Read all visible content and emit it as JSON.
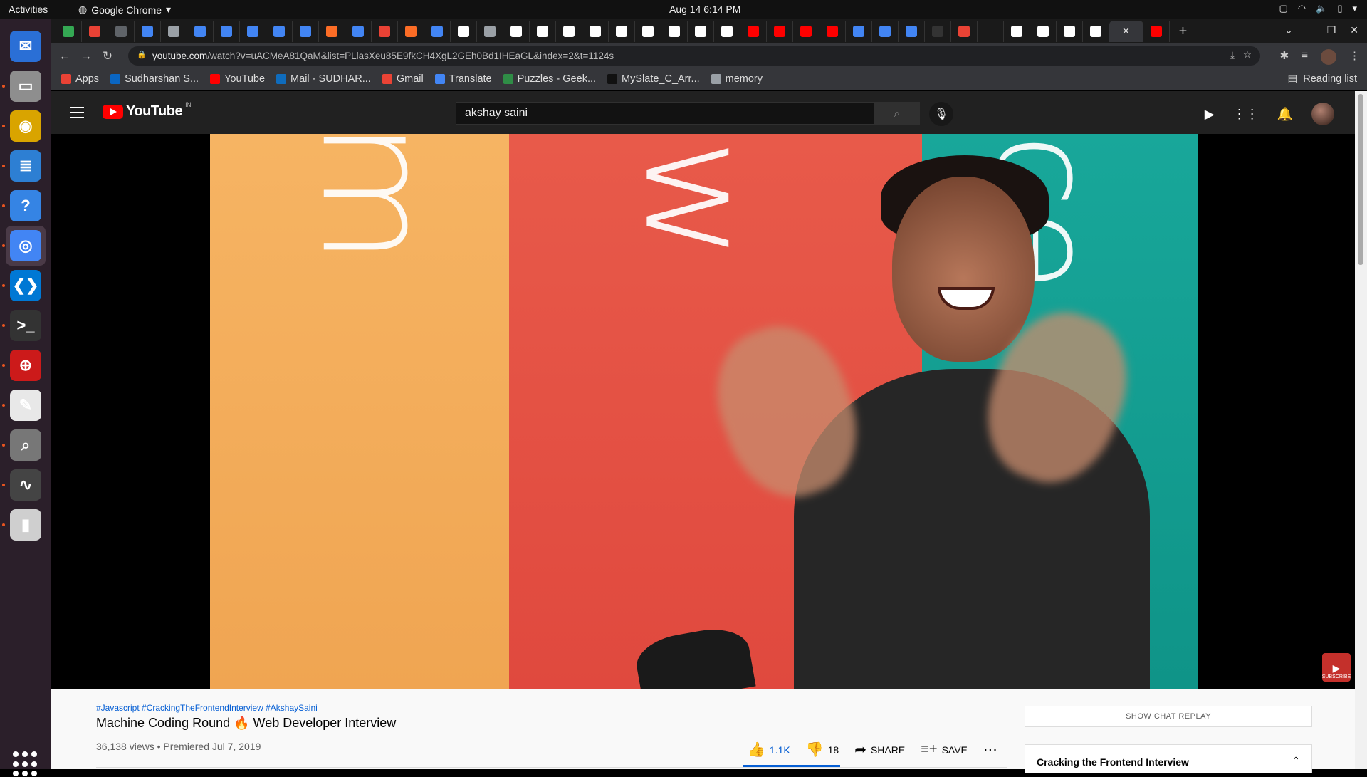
{
  "topbar": {
    "activities": "Activities",
    "app_name": "Google Chrome",
    "clock": "Aug 14  6:14 PM"
  },
  "dock": {
    "items": [
      {
        "name": "thunderbird-icon",
        "color": "#2a6fd6",
        "glyph": "✉"
      },
      {
        "name": "files-icon",
        "color": "#8e8e8e",
        "glyph": "▭"
      },
      {
        "name": "rhythmbox-icon",
        "color": "#d9a400",
        "glyph": "◉"
      },
      {
        "name": "libreoffice-writer-icon",
        "color": "#2d7fd3",
        "glyph": "≣"
      },
      {
        "name": "help-icon",
        "color": "#3584e4",
        "glyph": "?"
      },
      {
        "name": "chrome-icon",
        "color": "#4285f4",
        "glyph": "◎"
      },
      {
        "name": "vscode-icon",
        "color": "#0078d4",
        "glyph": "❮❯"
      },
      {
        "name": "terminal-icon",
        "color": "#333333",
        "glyph": ">_"
      },
      {
        "name": "ssl-vpn-icon",
        "color": "#cc1a1a",
        "glyph": "⊕"
      },
      {
        "name": "text-editor-icon",
        "color": "#e8e8e8",
        "glyph": "✎"
      },
      {
        "name": "image-viewer-icon",
        "color": "#777777",
        "glyph": "⌕"
      },
      {
        "name": "system-monitor-icon",
        "color": "#444444",
        "glyph": "∿"
      },
      {
        "name": "archive-manager-icon",
        "color": "#cfcfcf",
        "glyph": "▮"
      }
    ]
  },
  "browser": {
    "url_host": "youtube.com",
    "url_path": "/watch?v=uACMeA81QaM&list=PLlasXeu85E9fkCH4XgL2GEh0Bd1IHEaGL&index=2&t=1124s",
    "bookmarks": [
      {
        "label": "Apps",
        "color": "#e94235"
      },
      {
        "label": "Sudharshan S...",
        "color": "#0a66c2"
      },
      {
        "label": "YouTube",
        "color": "#ff0000"
      },
      {
        "label": "Mail - SUDHAR...",
        "color": "#0f6cbd"
      },
      {
        "label": "Gmail",
        "color": "#ea4335"
      },
      {
        "label": "Translate",
        "color": "#4285f4"
      },
      {
        "label": "Puzzles - Geek...",
        "color": "#2f8d46"
      },
      {
        "label": "MySlate_C_Arr...",
        "color": "#111111"
      },
      {
        "label": "memory",
        "color": "#9aa0a6"
      }
    ],
    "reading_list": "Reading list"
  },
  "youtube": {
    "logo_text": "YouTube",
    "country": "IN",
    "search_value": "akshay saini",
    "video": {
      "hashtags": "#Javascript #CrackingTheFrontendInterview #AkshaySaini",
      "title": "Machine Coding Round 🔥 Web Developer Interview",
      "meta": "36,138 views • Premiered Jul 7, 2019",
      "likes": "1.1K",
      "dislikes": "18",
      "share": "SHARE",
      "save": "SAVE",
      "subscribe_watermark": "SUBSCRIBE"
    },
    "chat_replay": "SHOW CHAT REPLAY",
    "playlist_title": "Cracking the Frontend Interview"
  }
}
